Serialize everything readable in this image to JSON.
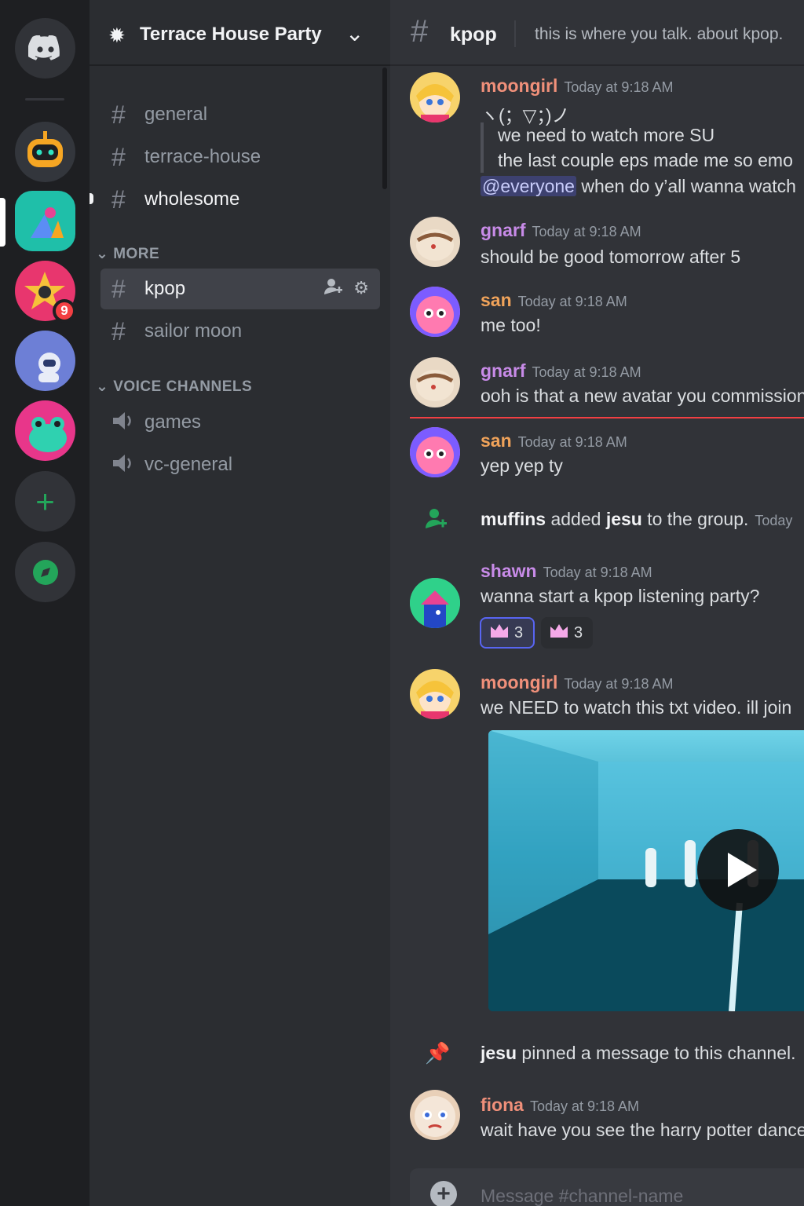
{
  "server": {
    "name": "Terrace House Party",
    "icons": [
      "discord-home-icon",
      "robot-server-icon",
      "shapes-server-icon",
      "star-server-icon",
      "astronaut-server-icon",
      "frog-server-icon",
      "add-server-icon",
      "explore-servers-icon"
    ],
    "unread_badge": "9"
  },
  "channels": {
    "top": [
      {
        "label": "general",
        "state": "read"
      },
      {
        "label": "terrace-house",
        "state": "read"
      },
      {
        "label": "wholesome",
        "state": "unread"
      }
    ],
    "more_label": "MORE",
    "more": [
      {
        "label": "kpop",
        "state": "active"
      },
      {
        "label": "sailor moon",
        "state": "read"
      }
    ],
    "voice_label": "VOICE CHANNELS",
    "voice": [
      {
        "label": "games"
      },
      {
        "label": "vc-general"
      }
    ]
  },
  "chat": {
    "channel": "kpop",
    "topic": "this is where you talk. about kpop.",
    "input_placeholder": "Message #channel-name",
    "messages": {
      "m1": {
        "user": "moongirl",
        "time": "Today at 9:18 AM",
        "kaomoji": "ヽ(；▽；)ノ",
        "quote1": "we need to watch more SU",
        "quote2": "the last couple eps made me so emo",
        "mention": "@everyone",
        "after_mention": " when do y’all wanna watch"
      },
      "m2": {
        "user": "gnarf",
        "time": "Today at 9:18 AM",
        "text": "should be good tomorrow after 5"
      },
      "m3": {
        "user": "san",
        "time": "Today at 9:18 AM",
        "text": "me too!"
      },
      "m4": {
        "user": "gnarf",
        "time": "Today at 9:18 AM",
        "text": "ooh is that a new avatar you commissioned"
      },
      "m5": {
        "user": "san",
        "time": "Today at 9:18 AM",
        "text": "yep yep ty"
      },
      "sys1": {
        "actor": "muffins",
        "middle": " added ",
        "target": "jesu",
        "end": " to the group.",
        "time": "Today"
      },
      "m6": {
        "user": "shawn",
        "time": "Today at 9:18 AM",
        "text": "wanna start a kpop listening party?",
        "reactions": [
          {
            "count": "3",
            "reacted": true
          },
          {
            "count": "3",
            "reacted": false
          }
        ]
      },
      "m7": {
        "user": "moongirl",
        "time": "Today at 9:18 AM",
        "text": "we NEED to watch this txt video. ill join"
      },
      "sys2": {
        "actor": "jesu",
        "rest": " pinned a message to this channel."
      },
      "m8": {
        "user": "fiona",
        "time": "Today at 9:18 AM",
        "text": "wait have you see the harry potter dance"
      }
    }
  },
  "colors": {
    "moongirl": "#f0907a",
    "gnarf": "#c88be8",
    "san": "#f0a35a",
    "shawn": "#c88be8",
    "fiona": "#f0907a",
    "accent": "#5865f2",
    "new_divider": "#f23f43"
  }
}
